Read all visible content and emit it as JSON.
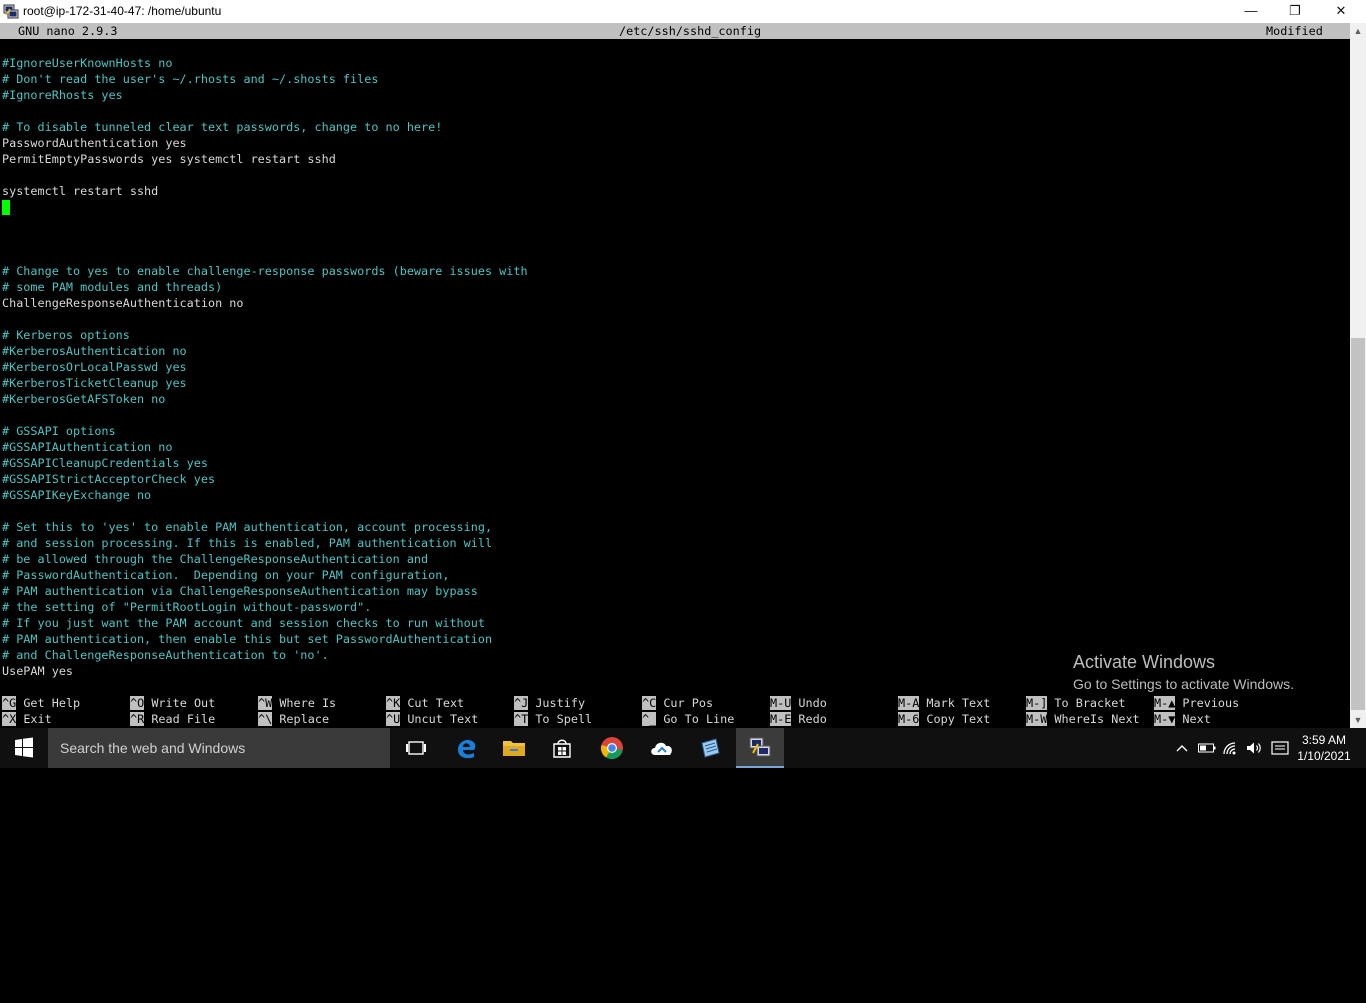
{
  "window": {
    "title": "root@ip-172-31-40-47: /home/ubuntu",
    "min_glyph": "—",
    "max_glyph": "❐",
    "close_glyph": "✕"
  },
  "nano": {
    "version": "GNU nano 2.9.3",
    "file": "/etc/ssh/sshd_config",
    "status": "Modified"
  },
  "lines": {
    "l1": "#IgnoreUserKnownHosts no",
    "l2": "# Don't read the user's ~/.rhosts and ~/.shosts files",
    "l3": "#IgnoreRhosts yes",
    "l4": "# To disable tunneled clear text passwords, change to no here!",
    "l5": "PasswordAuthentication yes",
    "l6": "PermitEmptyPasswords yes systemctl restart sshd",
    "l7": "systemctl restart sshd",
    "l8": "# Change to yes to enable challenge-response passwords (beware issues with",
    "l9": "# some PAM modules and threads)",
    "l10": "ChallengeResponseAuthentication no",
    "l11": "# Kerberos options",
    "l12": "#KerberosAuthentication no",
    "l13": "#KerberosOrLocalPasswd yes",
    "l14": "#KerberosTicketCleanup yes",
    "l15": "#KerberosGetAFSToken no",
    "l16": "# GSSAPI options",
    "l17": "#GSSAPIAuthentication no",
    "l18": "#GSSAPICleanupCredentials yes",
    "l19": "#GSSAPIStrictAcceptorCheck yes",
    "l20": "#GSSAPIKeyExchange no",
    "l21": "# Set this to 'yes' to enable PAM authentication, account processing,",
    "l22": "# and session processing. If this is enabled, PAM authentication will",
    "l23": "# be allowed through the ChallengeResponseAuthentication and",
    "l24": "# PasswordAuthentication.  Depending on your PAM configuration,",
    "l25": "# PAM authentication via ChallengeResponseAuthentication may bypass",
    "l26": "# the setting of \"PermitRootLogin without-password\".",
    "l27": "# If you just want the PAM account and session checks to run without",
    "l28": "# PAM authentication, then enable this but set PasswordAuthentication",
    "l29": "# and ChallengeResponseAuthentication to 'no'.",
    "l30": "UsePAM yes"
  },
  "shortcuts": {
    "get_help": {
      "key": "^G",
      "label": "Get Help"
    },
    "exit": {
      "key": "^X",
      "label": "Exit"
    },
    "write_out": {
      "key": "^O",
      "label": "Write Out"
    },
    "read_file": {
      "key": "^R",
      "label": "Read File"
    },
    "where_is": {
      "key": "^W",
      "label": "Where Is"
    },
    "replace": {
      "key": "^\\",
      "label": "Replace"
    },
    "cut_text": {
      "key": "^K",
      "label": "Cut Text"
    },
    "uncut_text": {
      "key": "^U",
      "label": "Uncut Text"
    },
    "justify": {
      "key": "^J",
      "label": "Justify"
    },
    "to_spell": {
      "key": "^T",
      "label": "To Spell"
    },
    "cur_pos": {
      "key": "^C",
      "label": "Cur Pos"
    },
    "go_to_line": {
      "key": "^_",
      "label": "Go To Line"
    },
    "undo": {
      "key": "M-U",
      "label": "Undo"
    },
    "redo": {
      "key": "M-E",
      "label": "Redo"
    },
    "mark_text": {
      "key": "M-A",
      "label": "Mark Text"
    },
    "copy_text": {
      "key": "M-6",
      "label": "Copy Text"
    },
    "to_bracket": {
      "key": "M-]",
      "label": "To Bracket"
    },
    "whereis_next": {
      "key": "M-W",
      "label": "WhereIs Next"
    },
    "previous": {
      "key": "M-▲",
      "label": "Previous"
    },
    "next": {
      "key": "M-▼",
      "label": "Next"
    }
  },
  "watermark": {
    "title": "Activate Windows",
    "subtitle": "Go to Settings to activate Windows."
  },
  "taskbar": {
    "search_placeholder": "Search the web and Windows",
    "time": "3:59 AM",
    "date": "1/10/2021"
  },
  "colors": {
    "comment": "#4ec3c3",
    "plain": "#d8d8d8",
    "cursor": "#00ff00",
    "header_bg": "#c0c0c0",
    "taskbar_bg": "#101010"
  }
}
